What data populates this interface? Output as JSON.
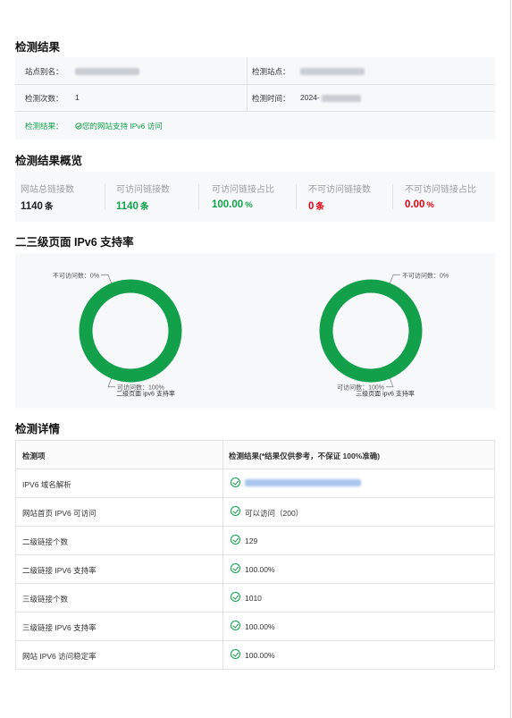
{
  "sections": {
    "result": "检测结果",
    "overview": "检测结果概览",
    "support_rate": "二三级页面 IPv6 支持率",
    "details": "检测详情"
  },
  "info": {
    "alias_label": "站点别名：",
    "site_label": "检测站点：",
    "count_label": "检测次数：",
    "count_value": "1",
    "time_label": "检测时间：",
    "time_value": "2024-",
    "result_label": "检测结果：",
    "result_value": "您的网站支持 IPv6 访问"
  },
  "overview": [
    {
      "label": "网站总链接数",
      "value": "1140",
      "unit": "条",
      "color": "#222222"
    },
    {
      "label": "可访问链接数",
      "value": "1140",
      "unit": "条",
      "color": "#12a04a"
    },
    {
      "label": "可访问链接占比",
      "value": "100.00",
      "unit": "%",
      "color": "#12a04a"
    },
    {
      "label": "不可访问链接数",
      "value": "0",
      "unit": "条",
      "color": "#e60012"
    },
    {
      "label": "不可访问链接占比",
      "value": "0.00",
      "unit": "%",
      "color": "#e60012"
    }
  ],
  "chart_data": [
    {
      "type": "pie",
      "title": "二级页面 ipv6 支持率",
      "labels": [
        "可访问数",
        "不可访问数"
      ],
      "values": [
        100,
        0
      ],
      "label_texts": [
        "可访问数：100%",
        "不可访问数：0%"
      ],
      "colors": [
        "#12a04a",
        "#e60012"
      ]
    },
    {
      "type": "pie",
      "title": "三级页面 ipv6 支持率",
      "labels": [
        "可访问数",
        "不可访问数"
      ],
      "values": [
        100,
        0
      ],
      "label_texts": [
        "可访问数：100%",
        "不可访问数：0%"
      ],
      "colors": [
        "#12a04a",
        "#e60012"
      ]
    }
  ],
  "table": {
    "headers": [
      "检测项",
      "检测结果(*结果仅供参考，不保证 100%准确)"
    ],
    "rows": [
      {
        "item": "IPV6 域名解析",
        "result": ""
      },
      {
        "item": "网站首页 IPV6 可访问",
        "result": "可以访问（200）"
      },
      {
        "item": "二级链接个数",
        "result": "129"
      },
      {
        "item": "二级链接 IPV6 支持率",
        "result": "100.00%"
      },
      {
        "item": "三级链接个数",
        "result": "1010"
      },
      {
        "item": "三级链接 IPV6 支持率",
        "result": "100.00%"
      },
      {
        "item": "网站 IPV6 访问稳定率",
        "result": "100.00%"
      }
    ]
  }
}
